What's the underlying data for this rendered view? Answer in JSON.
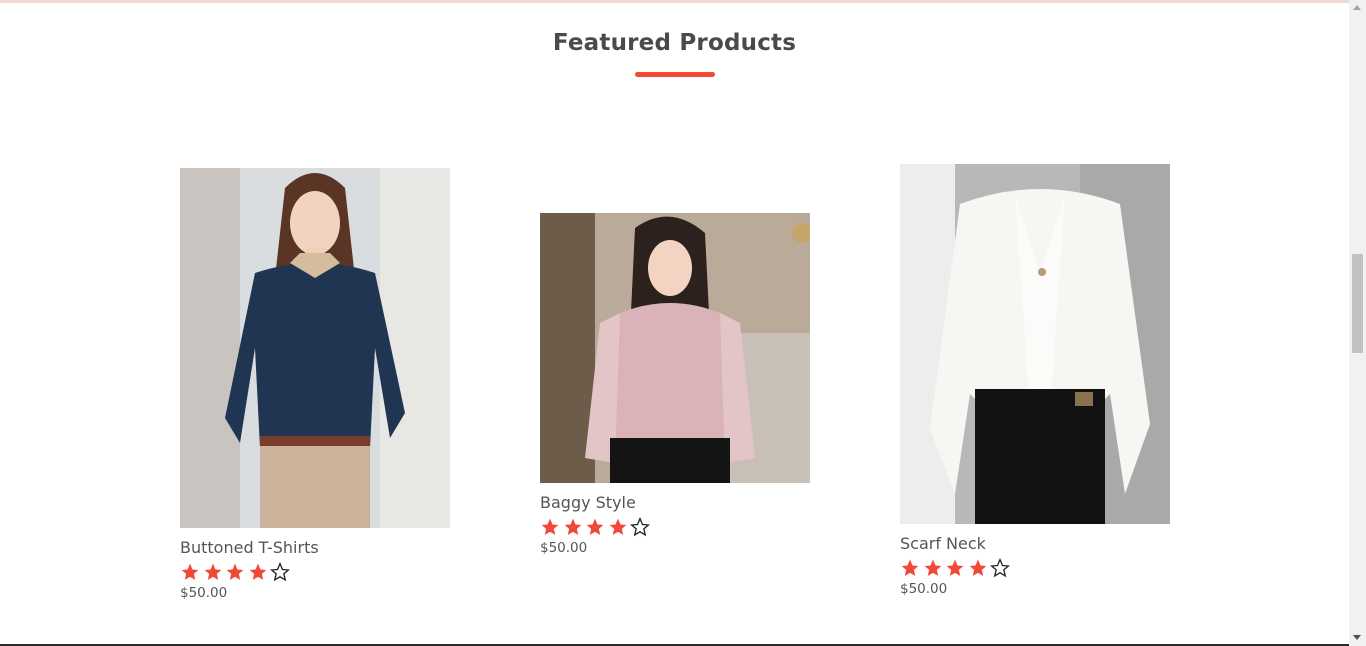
{
  "section": {
    "title": "Featured Products",
    "accent_color": "#f04a36"
  },
  "products": [
    {
      "name": "Buttoned T-Shirts",
      "price": "$50.00",
      "rating": 4,
      "max_rating": 5,
      "image": "woman-navy-buttoned-shirt"
    },
    {
      "name": "Baggy Style",
      "price": "$50.00",
      "rating": 4,
      "max_rating": 5,
      "image": "woman-pink-blouse-seated"
    },
    {
      "name": "Scarf Neck",
      "price": "$50.00",
      "rating": 4,
      "max_rating": 5,
      "image": "woman-white-scarf-neck-blouse"
    }
  ],
  "icons": {
    "filled_star": "star-filled-icon",
    "empty_star": "star-outline-icon"
  }
}
